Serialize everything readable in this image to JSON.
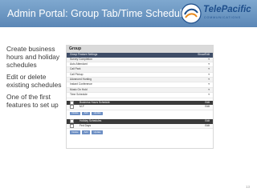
{
  "slide": {
    "title": "Admin Portal: Group Tab/Time Schedule",
    "page_number": "13"
  },
  "logo": {
    "name": "TelePacific",
    "tagline": "COMMUNICATIONS"
  },
  "bullets": [
    "Create business hours and holiday schedules",
    "Edit or delete existing schedules",
    "One of the first features to set up"
  ],
  "portal": {
    "panel_title": "Group",
    "features_header": "Group Feature Settings",
    "features_header_right": "Show/Edit",
    "features": [
      "Survey Completion",
      "Auto Attendant",
      "Call Park",
      "Call Pickup",
      "Advanced Hunting",
      "Instant Conference",
      "Music On Hold",
      "Time Schedule"
    ],
    "business": {
      "header": "Business Hours Schedule",
      "header_action": "Edit",
      "rows": [
        {
          "name": "M-F",
          "action": "Edit"
        }
      ],
      "buttons": [
        "Delete",
        "Add",
        "Update"
      ]
    },
    "holiday": {
      "header": "Holiday Schedules",
      "header_action": "Edit",
      "rows": [
        {
          "name": "Fed Days",
          "action": "Edit"
        }
      ],
      "buttons": [
        "Delete",
        "Add",
        "Update"
      ]
    }
  }
}
